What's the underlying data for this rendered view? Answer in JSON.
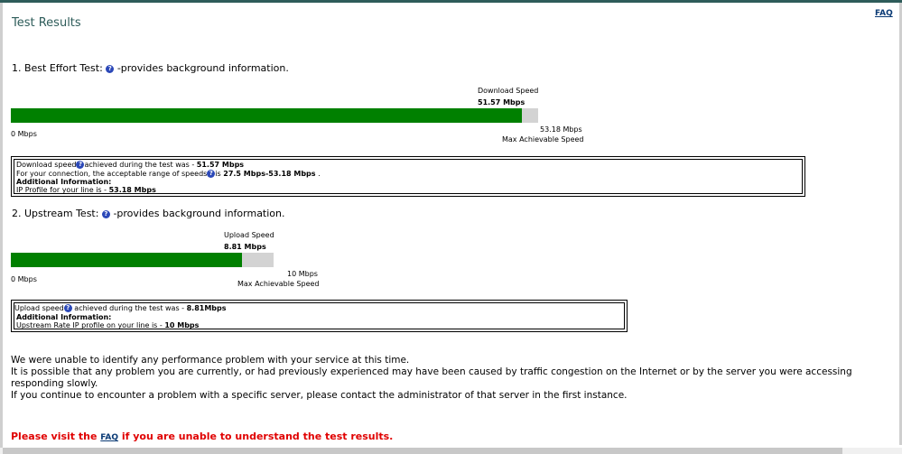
{
  "page": {
    "title": "Test Results",
    "faq_link": "FAQ"
  },
  "download_test": {
    "heading_prefix": "1. Best Effort Test:",
    "heading_suffix": "-provides background information.",
    "speed_label": "Download Speed",
    "speed_value": "51.57 Mbps",
    "min_label": "0 Mbps",
    "max_value": "53.18 Mbps",
    "max_label": "Max Achievable Speed",
    "fill_fraction": 0.9697,
    "info": {
      "line1_prefix": "Download speed",
      "line1_mid": "achieved during the test was - ",
      "line1_value": "51.57 Mbps",
      "line2_prefix": "For your connection, the acceptable range of speeds",
      "line2_mid": "is ",
      "line2_value": "27.5 Mbps-53.18 Mbps",
      "line2_suffix": " .",
      "line3": "Additional Information:",
      "line4_prefix": "IP Profile for your line is - ",
      "line4_value": "53.18 Mbps"
    }
  },
  "upload_test": {
    "heading_prefix": "2. Upstream Test:",
    "heading_suffix": "-provides background information.",
    "speed_label": "Upload Speed",
    "speed_value": "8.81 Mbps",
    "min_label": "0 Mbps",
    "max_value": "10 Mbps",
    "max_label": "Max Achievable Speed",
    "fill_fraction": 0.881,
    "info": {
      "line1_prefix": "Upload speed",
      "line1_mid": " achieved during the test was - ",
      "line1_value": "8.81Mbps",
      "line2": "Additional Information:",
      "line3_prefix": "Upstream Rate IP profile on your line is - ",
      "line3_value": "10 Mbps"
    }
  },
  "summary": {
    "line1": "We were unable to identify any performance problem with your service at this time.",
    "line2": "It is possible that any problem you are currently, or had previously experienced may have been caused by traffic congestion on the Internet or by the server you were accessing responding slowly.",
    "line3": "If you continue to encounter a problem with a specific server, please contact the administrator of that server in the first instance."
  },
  "footer": {
    "prefix": "Please visit the ",
    "link": "FAQ",
    "suffix": " if you are unable to understand the test results."
  },
  "colors": {
    "bar_fill": "#008000",
    "bar_background": "#d3d3d3",
    "title": "#2e5c5a",
    "footer_text": "#e00000"
  }
}
